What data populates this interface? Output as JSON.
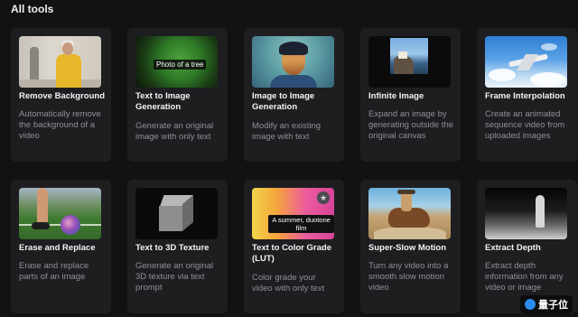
{
  "header": {
    "title": "All tools"
  },
  "tools": [
    {
      "name": "Remove Background",
      "desc1": "Automatically remove the background of a video",
      "desc2": ""
    },
    {
      "name": "Text to Image Generation",
      "desc1": "Generate an original image with only text",
      "thumb_caption": "Photo of a tree"
    },
    {
      "name": "Image to Image Generation",
      "desc1": "Modify an existing image with text"
    },
    {
      "name": "Infinite Image",
      "desc1": "Expand an image by generating outside the original canvas"
    },
    {
      "name": "Frame Interpolation",
      "desc1": "Create an animated sequence video from uploaded images"
    },
    {
      "name": "Erase and Replace",
      "desc1": "Erase and replace parts of an image"
    },
    {
      "name": "Text to 3D Texture",
      "desc1": "Generate an original 3D texture via text prompt"
    },
    {
      "name": "Text to Color Grade (LUT)",
      "desc1": "Color grade your video with only text",
      "thumb_caption": "A summer, duotone film"
    },
    {
      "name": "Super-Slow Motion",
      "desc1": "Turn any video into a smooth slow motion video"
    },
    {
      "name": "Extract Depth",
      "desc1": "Extract depth information from any video or image"
    }
  ],
  "watermark": {
    "text": "量子位"
  }
}
